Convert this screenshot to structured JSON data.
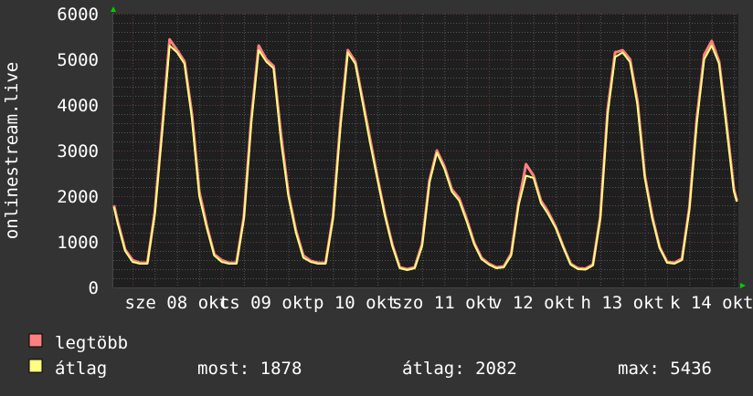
{
  "chart_data": {
    "type": "line",
    "ylabel": "onlinestream.live",
    "ylim": [
      0,
      6000
    ],
    "yticks": [
      "0",
      "1000",
      "2000",
      "3000",
      "4000",
      "5000",
      "6000"
    ],
    "ytick_values": [
      0,
      1000,
      2000,
      3000,
      4000,
      5000,
      6000
    ],
    "x_unit": "hours since 08 okt 00:00",
    "xlim": [
      -5.2,
      163.2
    ],
    "xtick_labels": [
      "sze 08 okt",
      "cs 09 okt",
      "p 10 okt",
      "szo 11 okt",
      "v 12 okt",
      "h 13 okt",
      "k 14 okt"
    ],
    "xtick_hours": [
      12,
      36,
      60,
      84,
      108,
      132,
      156
    ],
    "grid": true,
    "legend_position": "bottom-left",
    "x": [
      -5,
      -4,
      -2,
      0,
      2,
      4,
      6,
      8,
      10,
      12,
      14,
      16,
      18,
      20,
      22,
      24,
      26,
      28,
      30,
      32,
      34,
      36,
      38,
      40,
      42,
      44,
      46,
      48,
      50,
      52,
      54,
      56,
      58,
      60,
      62,
      64,
      66,
      68,
      70,
      72,
      74,
      76,
      78,
      80,
      82,
      84,
      86,
      88,
      90,
      92,
      94,
      96,
      98,
      100,
      102,
      104,
      106,
      108,
      110,
      112,
      114,
      116,
      118,
      120,
      122,
      124,
      126,
      128,
      130,
      132,
      134,
      136,
      138,
      140,
      142,
      144,
      146,
      148,
      150,
      152,
      154,
      156,
      158,
      160,
      162,
      162.8
    ],
    "series": [
      {
        "name": "legtöbb",
        "color": "#ff8080",
        "values": [
          1800,
          1450,
          830,
          600,
          540,
          540,
          1650,
          3500,
          5436,
          5200,
          4950,
          3800,
          2100,
          1350,
          730,
          600,
          540,
          540,
          1550,
          3700,
          5300,
          5000,
          4850,
          3350,
          2050,
          1250,
          700,
          580,
          540,
          540,
          1550,
          3600,
          5200,
          4950,
          4100,
          3250,
          2400,
          1600,
          930,
          440,
          400,
          440,
          950,
          2350,
          3000,
          2650,
          2150,
          1950,
          1500,
          980,
          650,
          520,
          440,
          460,
          740,
          1850,
          2700,
          2450,
          1900,
          1650,
          1330,
          900,
          520,
          420,
          410,
          500,
          1550,
          3900,
          5150,
          5200,
          5000,
          4100,
          2450,
          1550,
          880,
          560,
          540,
          630,
          1750,
          3700,
          5100,
          5400,
          4950,
          3600,
          2150,
          1900
        ]
      },
      {
        "name": "átlag",
        "color": "#ffff80",
        "values": [
          1760,
          1400,
          800,
          560,
          520,
          520,
          1600,
          3400,
          5300,
          5150,
          4900,
          3700,
          2000,
          1300,
          700,
          560,
          520,
          520,
          1500,
          3600,
          5200,
          4950,
          4800,
          3200,
          2000,
          1200,
          650,
          560,
          520,
          520,
          1500,
          3500,
          5150,
          4900,
          4040,
          3160,
          2360,
          1560,
          900,
          420,
          380,
          420,
          900,
          2300,
          2950,
          2600,
          2100,
          1900,
          1450,
          950,
          620,
          500,
          420,
          440,
          700,
          1800,
          2450,
          2400,
          1850,
          1600,
          1300,
          880,
          500,
          400,
          390,
          480,
          1500,
          3800,
          5050,
          5150,
          4940,
          4000,
          2400,
          1500,
          860,
          540,
          520,
          600,
          1700,
          3600,
          5000,
          5300,
          4900,
          3500,
          2100,
          1878
        ]
      }
    ]
  },
  "legend": {
    "max_label": "legtöbb",
    "avg_label": "átlag",
    "now": "most: 1878",
    "average": "átlag: 2082",
    "maximum": "max: 5436"
  },
  "colors": {
    "background": "#333333",
    "plot": "#1f1f1f",
    "max": "#ff8080",
    "avg": "#ffff80",
    "arrow": "#00cc00"
  }
}
